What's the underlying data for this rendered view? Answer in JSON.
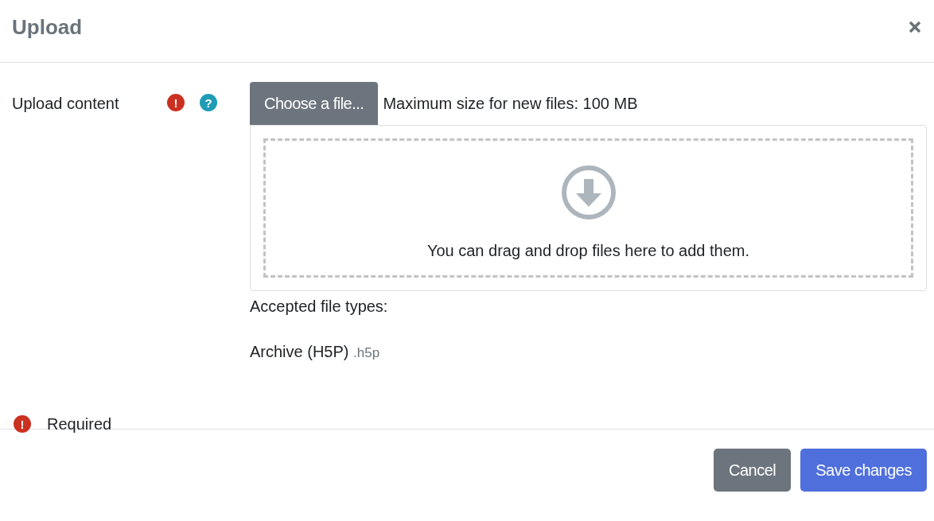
{
  "dialog": {
    "title": "Upload"
  },
  "field": {
    "label": "Upload content",
    "required_icon": "!",
    "help_icon": "?"
  },
  "file_picker": {
    "button": "Choose a file...",
    "max_size": "Maximum size for new files: 100 MB",
    "drop_hint": "You can drag and drop files here to add them."
  },
  "accepted": {
    "heading": "Accepted file types:",
    "types": [
      {
        "name": "Archive (H5P)",
        "extension": ".h5p"
      }
    ]
  },
  "legend": {
    "icon": "!",
    "text": "Required"
  },
  "buttons": [
    {
      "label": "Cancel",
      "kind": "secondary"
    },
    {
      "label": "Save changes",
      "kind": "primary"
    }
  ]
}
